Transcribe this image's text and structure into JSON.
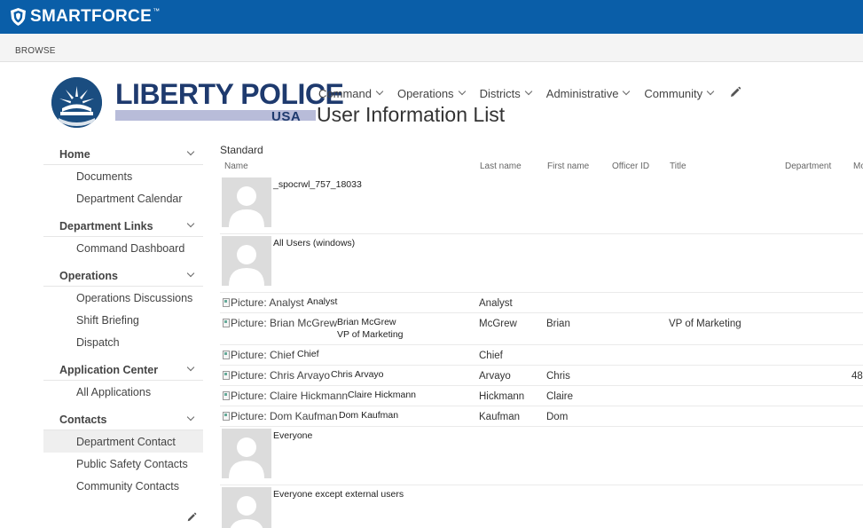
{
  "suite": {
    "brand": "SMARTFORCE",
    "tm": "™"
  },
  "ribbon": {
    "tab": "BROWSE"
  },
  "logo": {
    "title": "LIBERTY POLICE",
    "sub": "USA"
  },
  "topnav": [
    {
      "label": "Command"
    },
    {
      "label": "Operations"
    },
    {
      "label": "Districts"
    },
    {
      "label": "Administrative"
    },
    {
      "label": "Community"
    }
  ],
  "page": {
    "title": "User Information List"
  },
  "leftnav": {
    "sections": [
      {
        "label": "Home",
        "items": [
          "Documents",
          "Department Calendar"
        ]
      },
      {
        "label": "Department Links",
        "items": [
          "Command Dashboard"
        ]
      },
      {
        "label": "Operations",
        "items": [
          "Operations Discussions",
          "Shift Briefing",
          "Dispatch"
        ]
      },
      {
        "label": "Application Center",
        "items": [
          "All Applications"
        ]
      },
      {
        "label": "Contacts",
        "items": [
          "Department Contact",
          "Public Safety Contacts",
          "Community Contacts"
        ]
      }
    ],
    "selected": "Department Contact"
  },
  "list": {
    "view": "Standard",
    "columns": [
      "Name",
      "Last name",
      "First name",
      "Officer ID",
      "Title",
      "Department",
      "Mo"
    ],
    "rows": [
      {
        "kind": "avatar",
        "name": "_spocrwl_757_18033",
        "last": "",
        "first": "",
        "title": "",
        "extra": ""
      },
      {
        "kind": "avatar",
        "name": "All Users (windows)",
        "last": "",
        "first": "",
        "title": "",
        "extra": ""
      },
      {
        "kind": "broken",
        "alt": "Picture: Analyst",
        "name": "Analyst",
        "sub": "",
        "last": "Analyst",
        "first": "",
        "title": "",
        "extra": ""
      },
      {
        "kind": "broken",
        "alt": "Picture: Brian McGrew",
        "name": "Brian McGrew",
        "sub": "VP of Marketing",
        "last": "McGrew",
        "first": "Brian",
        "title": "VP of Marketing",
        "extra": ""
      },
      {
        "kind": "broken",
        "alt": "Picture: Chief",
        "name": "Chief",
        "sub": "",
        "last": "Chief",
        "first": "",
        "title": "",
        "extra": ""
      },
      {
        "kind": "broken",
        "alt": "Picture: Chris Arvayo",
        "name": "Chris Arvayo",
        "sub": "",
        "last": "Arvayo",
        "first": "Chris",
        "title": "",
        "extra": "48"
      },
      {
        "kind": "broken",
        "alt": "Picture: Claire Hickmann",
        "name": "Claire Hickmann",
        "sub": "",
        "last": "Hickmann",
        "first": "Claire",
        "title": "",
        "extra": ""
      },
      {
        "kind": "broken",
        "alt": "Picture: Dom Kaufman",
        "name": "Dom Kaufman",
        "sub": "",
        "last": "Kaufman",
        "first": "Dom",
        "title": "",
        "extra": ""
      },
      {
        "kind": "avatar",
        "name": "Everyone",
        "last": "",
        "first": "",
        "title": "",
        "extra": ""
      },
      {
        "kind": "avatar",
        "name": "Everyone except external users",
        "last": "",
        "first": "",
        "title": "",
        "extra": ""
      }
    ]
  },
  "colors": {
    "suitebar": "#0a5ea8",
    "logo_blue": "#1e3a6e",
    "logo_bar": "#b8bcd9"
  }
}
